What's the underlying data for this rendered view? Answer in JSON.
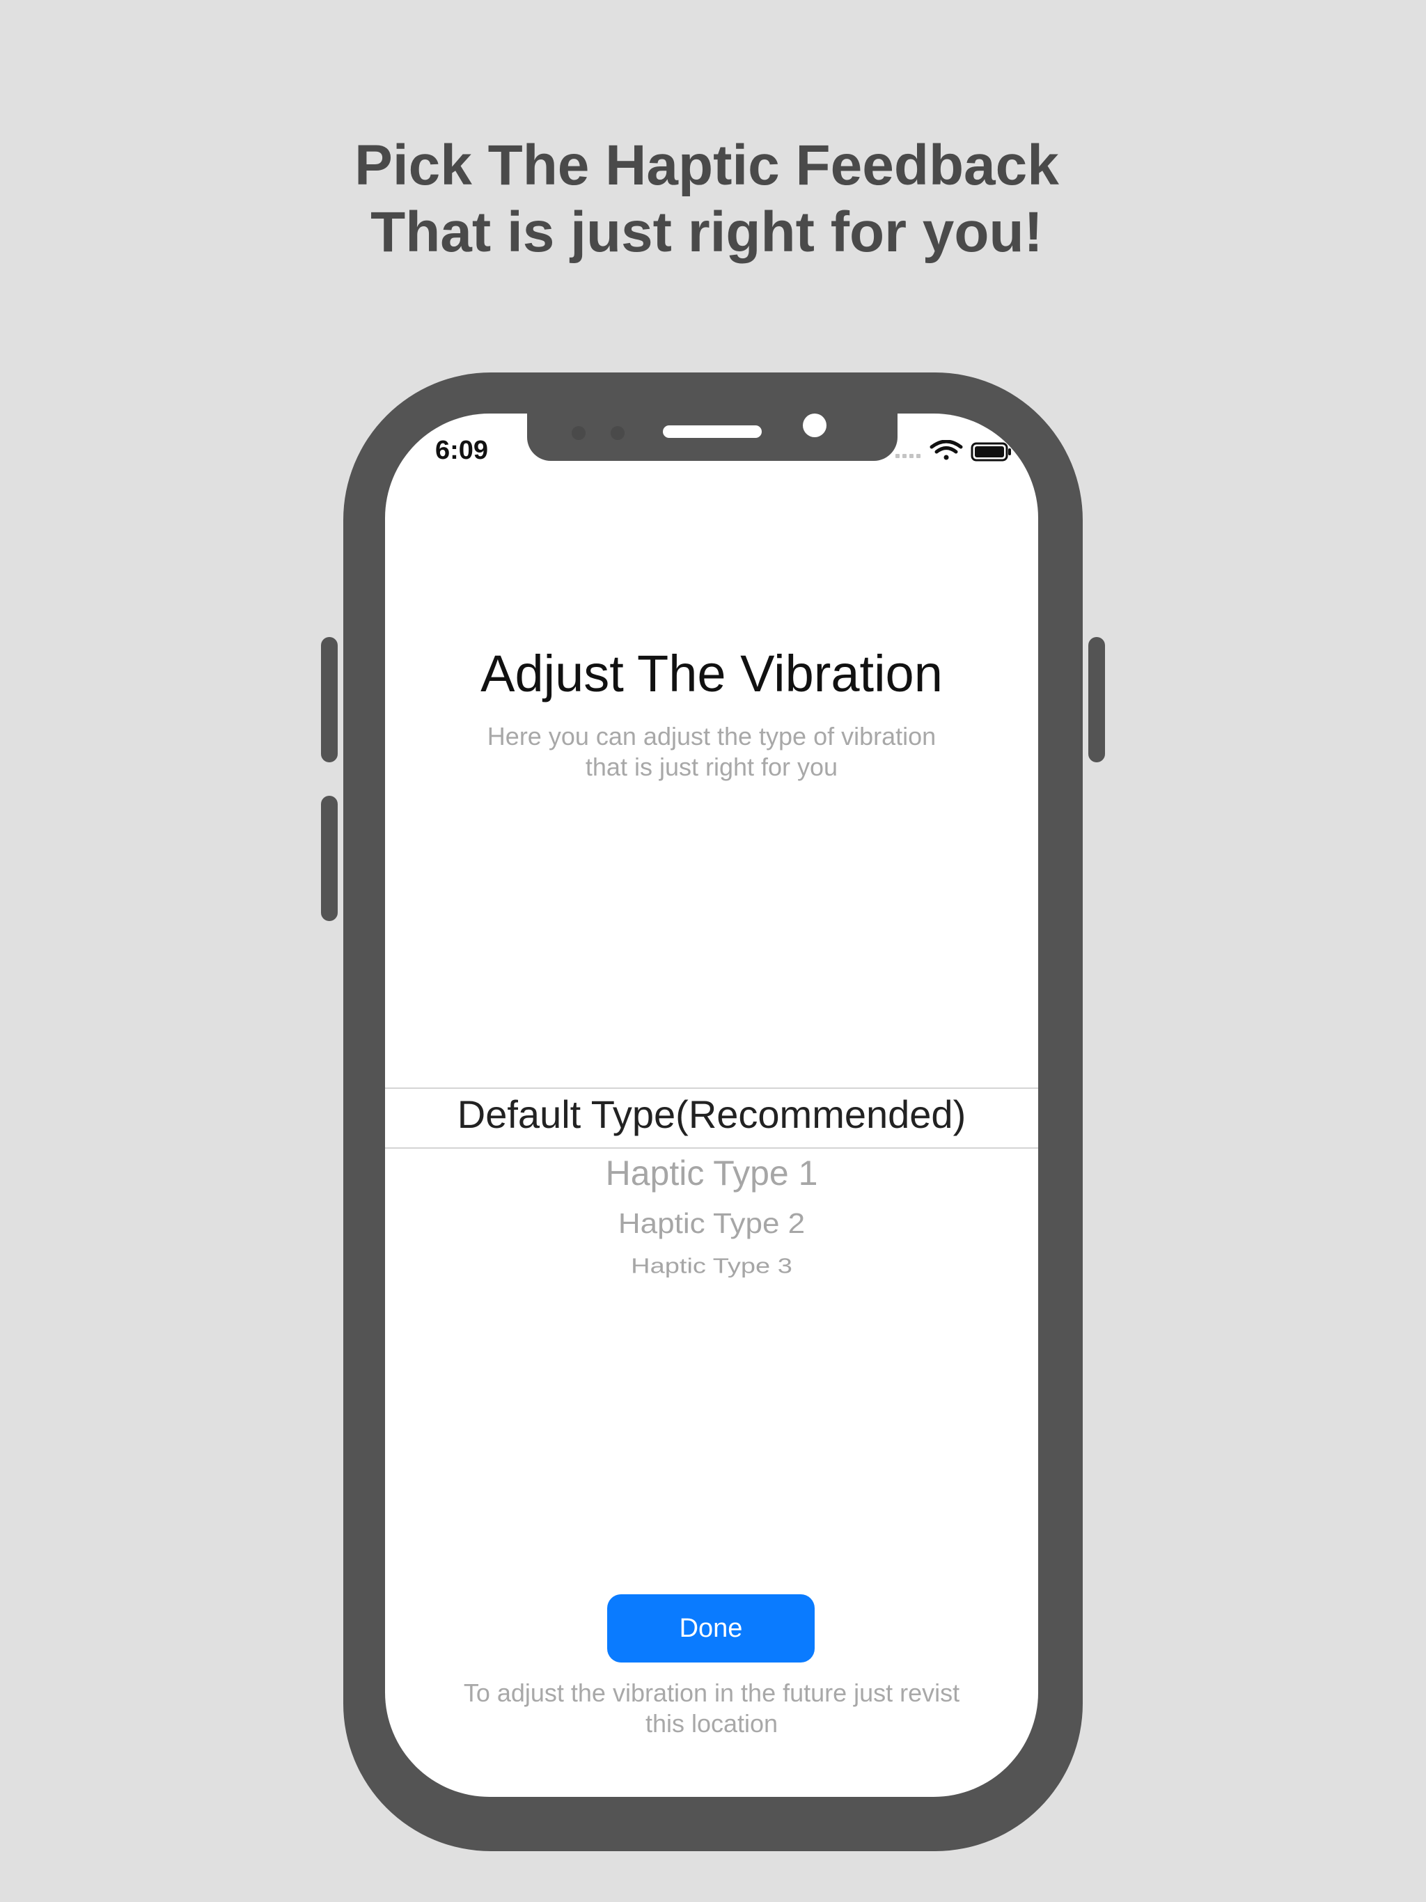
{
  "headline": {
    "line1": "Pick The Haptic Feedback",
    "line2": "That is just right for you!"
  },
  "status_bar": {
    "time": "6:09",
    "icons": [
      "signal-icon",
      "wifi-icon",
      "battery-icon"
    ]
  },
  "screen": {
    "title": "Adjust The Vibration",
    "subtitle_line1": "Here you can adjust the type of vibration",
    "subtitle_line2": "that is just right for you"
  },
  "picker": {
    "selected": "Default Type(Recommended)",
    "options": [
      "Haptic Type 1",
      "Haptic Type 2",
      "Haptic Type 3"
    ]
  },
  "actions": {
    "done_label": "Done"
  },
  "footer": {
    "line1": "To adjust the vibration in the future just revist",
    "line2": "this location"
  },
  "colors": {
    "background": "#e0e0e0",
    "device_frame": "#545454",
    "accent": "#0a7bff",
    "muted_text": "#a8a8a8"
  }
}
